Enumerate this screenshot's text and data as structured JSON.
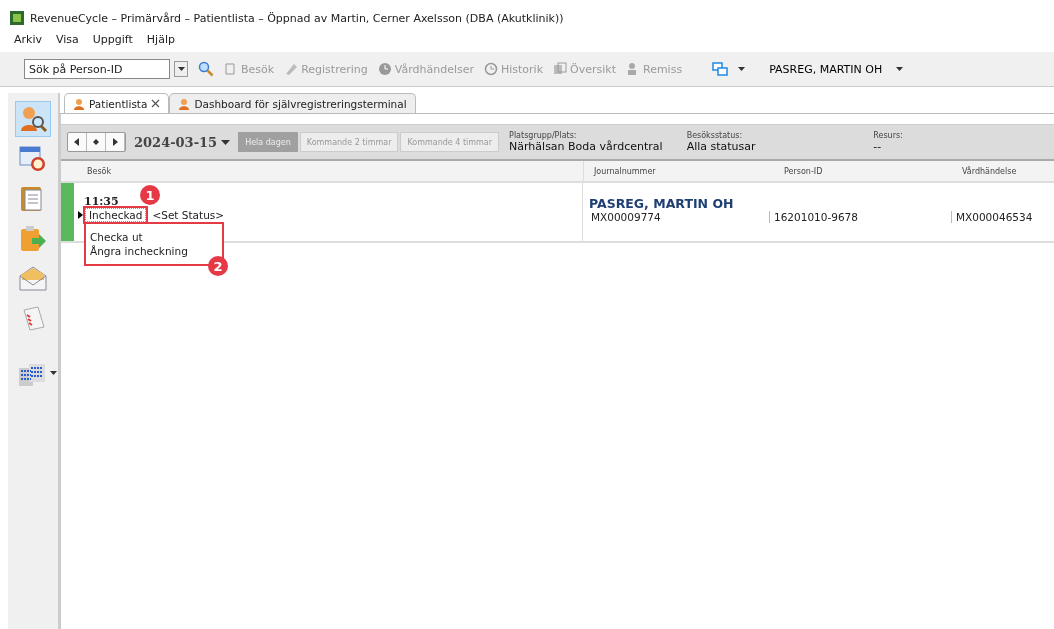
{
  "window": {
    "title": "RevenueCycle – Primärvård – Patientlista – Öppnad av Martin, Cerner Axelsson (DBA (Akutklinik))"
  },
  "menu": [
    "Arkiv",
    "Visa",
    "Uppgift",
    "Hjälp"
  ],
  "toolbar": {
    "search": {
      "placeholder": "Sök på Person-ID"
    },
    "buttons": [
      {
        "label": "Besök",
        "disabled": true
      },
      {
        "label": "Registrering",
        "disabled": true
      },
      {
        "label": "Vårdhändelser",
        "disabled": true
      },
      {
        "label": "Historik",
        "disabled": true
      },
      {
        "label": "Översikt",
        "disabled": true
      },
      {
        "label": "Remiss",
        "disabled": true
      }
    ],
    "user": "PASREG, MARTIN OH"
  },
  "sidebar": {
    "items": [
      {
        "kind": "search-person",
        "selected": true
      },
      {
        "kind": "calendar",
        "selected": false
      },
      {
        "kind": "clipboard",
        "selected": false
      },
      {
        "kind": "transfer",
        "selected": false
      },
      {
        "kind": "mail",
        "selected": false
      },
      {
        "kind": "checklist",
        "selected": false
      },
      {
        "kind": "buildings",
        "selected": false
      }
    ]
  },
  "tabs": [
    {
      "label": "Patientlista",
      "selected": true,
      "closable": true
    },
    {
      "label": "Dashboard för självregistreringsterminal",
      "selected": false,
      "closable": false
    }
  ],
  "filter": {
    "date": "2024-03-15",
    "ranges": [
      {
        "label": "Hela dagen",
        "selected": true
      },
      {
        "label": "Kommande 2 timmar",
        "selected": false
      },
      {
        "label": "Kommande 4 timmar",
        "selected": false
      }
    ],
    "fields": [
      {
        "label": "Platsgrupp/Plats:",
        "value": "Närhälsan Boda vårdcentral"
      },
      {
        "label": "Besöksstatus:",
        "value": "Alla statusar"
      },
      {
        "label": "Resurs:",
        "value": "--"
      }
    ]
  },
  "table": {
    "columns": [
      "Besök",
      "Journalnummer",
      "Person-ID",
      "Vårdhändelse"
    ],
    "rows": [
      {
        "time": "11:35",
        "status": "Incheckad",
        "set_status": "<Set Status>",
        "name": "PASREG, MARTIN OH",
        "journal": "MX00009774",
        "person_id": "16201010-9678",
        "episode": "MX000046534",
        "color": "#5cb85c"
      }
    ]
  },
  "status_menu": {
    "items": [
      "Checka ut",
      "Ångra incheckning"
    ]
  },
  "annotations": [
    {
      "label": "1"
    },
    {
      "label": "2"
    }
  ]
}
